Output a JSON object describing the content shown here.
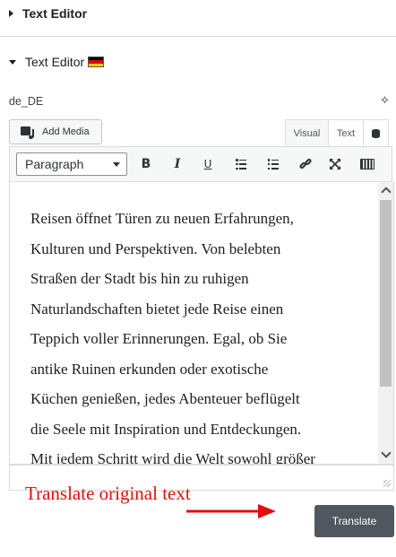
{
  "sections": {
    "collapsed_title": "Text Editor",
    "expanded_title": "Text Editor",
    "flag_colors": [
      "#000000",
      "#dd0000",
      "#ffce00"
    ]
  },
  "locale": "de_DE",
  "toolbar": {
    "add_media_label": "Add Media",
    "tabs": {
      "visual": "Visual",
      "text": "Text"
    },
    "format_select_value": "Paragraph",
    "bold_label": "B",
    "italic_label": "I",
    "underline_label": "U"
  },
  "editor": {
    "content_lines": [
      "Reisen öffnet Türen zu neuen Erfahrungen,",
      "Kulturen und Perspektiven. Von belebten",
      "Straßen der Stadt bis hin zu ruhigen",
      "Naturlandschaften bietet jede Reise einen",
      "Teppich voller Erinnerungen. Egal, ob Sie",
      "antike Ruinen erkunden oder exotische",
      "Küchen genießen, jedes Abenteuer beflügelt",
      "die Seele mit Inspiration und Entdeckungen.",
      "Mit jedem Schritt wird die Welt sowohl größer"
    ]
  },
  "annotation": {
    "text": "Translate original text",
    "color": "#e0100c"
  },
  "translate_button_label": "Translate"
}
